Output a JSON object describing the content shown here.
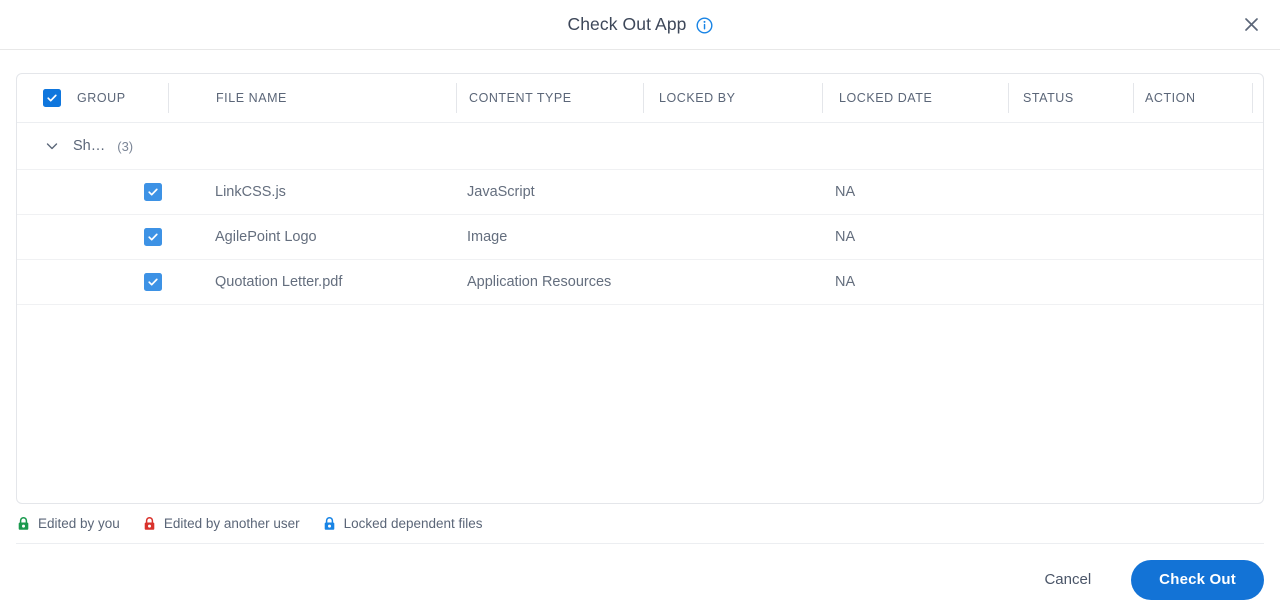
{
  "dialog": {
    "title": "Check Out App",
    "info_icon": "info-circle-icon",
    "close_icon": "close-icon"
  },
  "table": {
    "select_all_checked": true,
    "columns": [
      {
        "key": "group",
        "label": "GROUP"
      },
      {
        "key": "file",
        "label": "FILE NAME"
      },
      {
        "key": "type",
        "label": "CONTENT TYPE"
      },
      {
        "key": "lockby",
        "label": "LOCKED BY"
      },
      {
        "key": "lockdt",
        "label": "LOCKED DATE"
      },
      {
        "key": "status",
        "label": "STATUS"
      },
      {
        "key": "action",
        "label": "ACTION"
      }
    ],
    "group": {
      "expanded": true,
      "chevron_icon": "chevron-down-icon",
      "name": "Sh…",
      "count": "(3)"
    },
    "rows": [
      {
        "checked": true,
        "file_name": "LinkCSS.js",
        "content_type": "JavaScript",
        "locked_by": "",
        "locked_date": "NA",
        "status": "",
        "action": ""
      },
      {
        "checked": true,
        "file_name": "AgilePoint Logo",
        "content_type": "Image",
        "locked_by": "",
        "locked_date": "NA",
        "status": "",
        "action": ""
      },
      {
        "checked": true,
        "file_name": "Quotation Letter.pdf",
        "content_type": "Application Resources",
        "locked_by": "",
        "locked_date": "NA",
        "status": "",
        "action": ""
      }
    ]
  },
  "legend": [
    {
      "icon": "lock-green-icon",
      "label": "Edited by you",
      "color": "#1a9a4e"
    },
    {
      "icon": "lock-red-icon",
      "label": "Edited by another user",
      "color": "#d9322c"
    },
    {
      "icon": "lock-blue-icon",
      "label": "Locked dependent files",
      "color": "#1884e5"
    }
  ],
  "footer": {
    "cancel_label": "Cancel",
    "submit_label": "Check Out"
  },
  "colors": {
    "primary": "#1373d6",
    "header_checkbox": "#0f76dd",
    "row_checkbox": "#3d92e5",
    "title_text": "#3d4759",
    "header_text": "#5b6678",
    "cell_text": "#646e7e",
    "border": "#e4e6ea"
  }
}
